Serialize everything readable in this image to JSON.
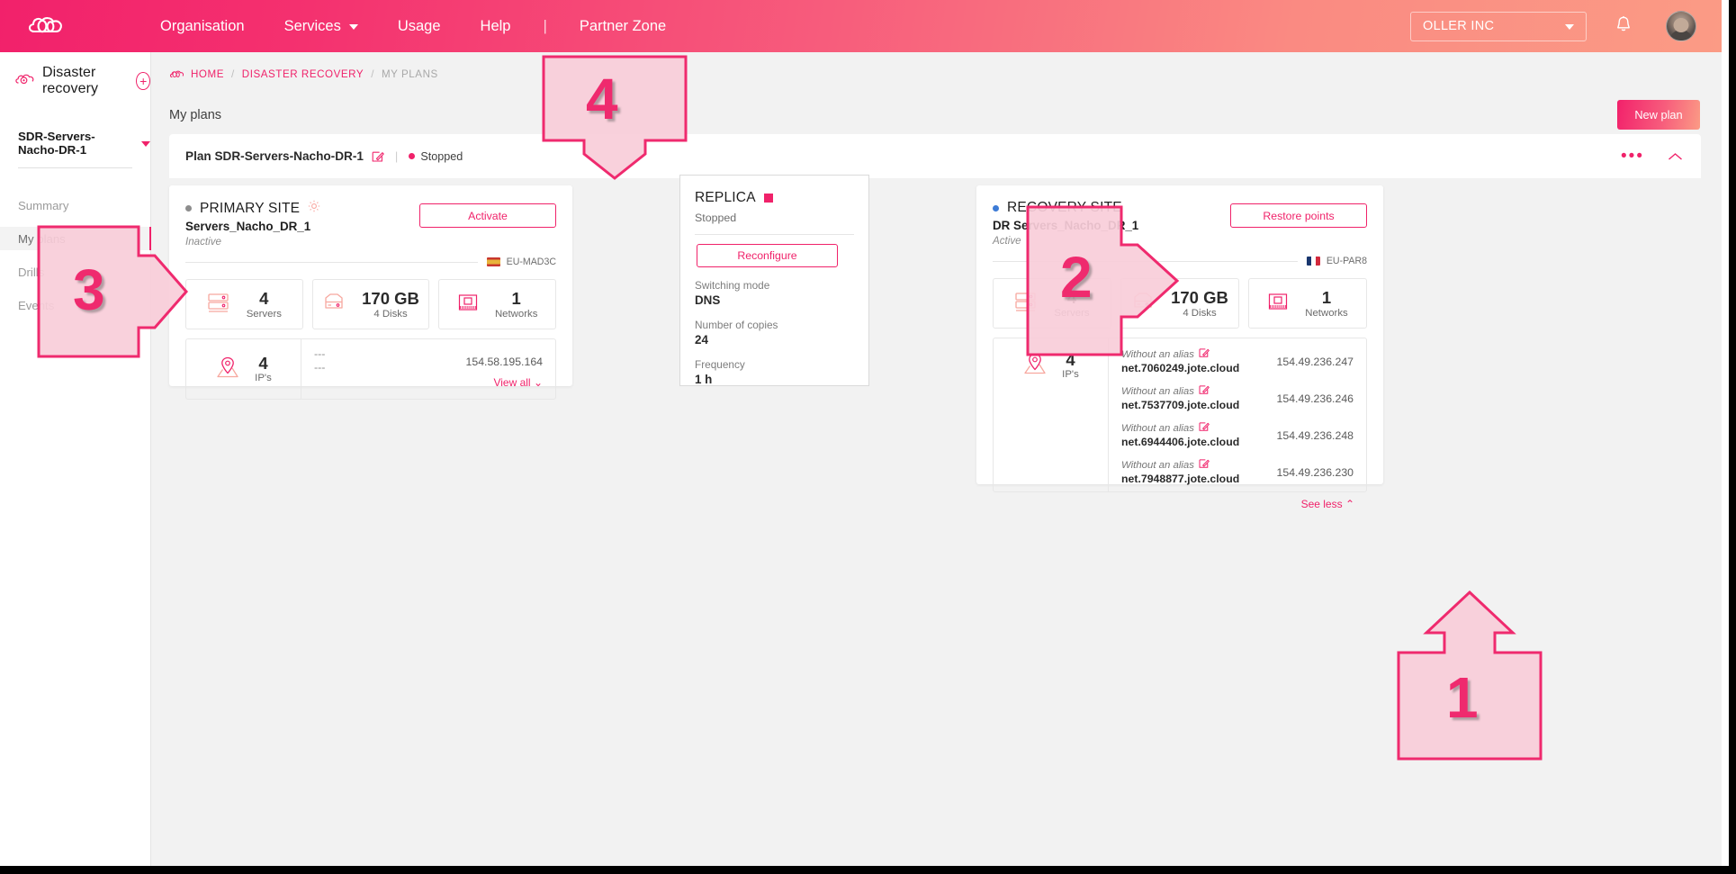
{
  "topnav": {
    "logo_icon": "cloud-logo-icon",
    "links": [
      {
        "label": "Organisation",
        "has_caret": false
      },
      {
        "label": "Services",
        "has_caret": true
      },
      {
        "label": "Usage",
        "has_caret": false
      },
      {
        "label": "Help",
        "has_caret": false
      }
    ],
    "separator": "|",
    "partner_link": "Partner Zone",
    "org_selector": "OLLER INC",
    "bell_icon": "notification-bell-icon",
    "avatar_icon": "user-avatar"
  },
  "sidebar": {
    "service_icon": "disaster-recovery-cloud-icon",
    "title": "Disaster recovery",
    "add_label": "+",
    "plan_selector": "SDR-Servers-Nacho-DR-1",
    "items": [
      {
        "label": "Summary",
        "active": false
      },
      {
        "label": "My plans",
        "active": true
      },
      {
        "label": "Drills",
        "active": false
      },
      {
        "label": "Events",
        "active": false
      }
    ]
  },
  "breadcrumb": {
    "home_icon": "cloud-home-icon",
    "items": [
      "HOME",
      "DISASTER RECOVERY",
      "MY PLANS"
    ],
    "separator": "/"
  },
  "page": {
    "title": "My plans",
    "new_plan_label": "New plan"
  },
  "plan_bar": {
    "name": "Plan SDR-Servers-Nacho-DR-1",
    "edit_icon": "edit-pencil-icon",
    "pipe": "|",
    "status": "Stopped",
    "status_color": "#f0226a",
    "more_icon": "more-dots-icon",
    "collapse_icon": "chevron-up-icon"
  },
  "primary_site": {
    "bullet_color": "#8d8d8d",
    "title": "PRIMARY SITE",
    "gear_icon": "gear-icon",
    "name": "Servers_Nacho_DR_1",
    "state": "Inactive",
    "action_label": "Activate",
    "region": "EU-MAD3C",
    "flag": "flag-es",
    "stats": [
      {
        "icon": "server-stack-icon",
        "value": "4",
        "label": "Servers"
      },
      {
        "icon": "disk-icon",
        "value": "170 GB",
        "label": "4 Disks"
      },
      {
        "icon": "network-icon",
        "value": "1",
        "label": "Networks"
      }
    ],
    "ip_icon": "location-pin-icon",
    "ip_count": "4",
    "ip_label": "IP's",
    "dash_1": "---",
    "dash_2": "---",
    "ip_address": "154.58.195.164",
    "view_all_label": "View all"
  },
  "replica": {
    "title": "REPLICA",
    "status_color": "#f0226a",
    "state": "Stopped",
    "action_label": "Reconfigure",
    "fields": [
      {
        "label": "Switching mode",
        "value": "DNS"
      },
      {
        "label": "Number of copies",
        "value": "24"
      },
      {
        "label": "Frequency",
        "value": "1 h"
      }
    ]
  },
  "recovery_site": {
    "bullet_color": "#3d7bd6",
    "title": "RECOVERY SITE",
    "name": "DR Servers_Nacho_DR_1",
    "state": "Active",
    "action_label": "Restore points",
    "region": "EU-PAR8",
    "flag": "flag-fr",
    "stats": [
      {
        "icon": "server-stack-icon",
        "value": "4",
        "label": "Servers"
      },
      {
        "icon": "disk-icon",
        "value": "170 GB",
        "label": "4 Disks"
      },
      {
        "icon": "network-icon",
        "value": "1",
        "label": "Networks"
      }
    ],
    "ip_icon": "location-pin-icon",
    "ip_count": "4",
    "ip_label": "IP's",
    "ips": [
      {
        "alias": "Without an alias",
        "fqdn": "net.7060249.jote.cloud",
        "address": "154.49.236.247"
      },
      {
        "alias": "Without an alias",
        "fqdn": "net.7537709.jote.cloud",
        "address": "154.49.236.246"
      },
      {
        "alias": "Without an alias",
        "fqdn": "net.6944406.jote.cloud",
        "address": "154.49.236.248"
      },
      {
        "alias": "Without an alias",
        "fqdn": "net.7948877.jote.cloud",
        "address": "154.49.236.230"
      }
    ],
    "see_less_label": "See less"
  },
  "annotations": [
    {
      "id": "1",
      "label": "1",
      "direction": "up"
    },
    {
      "id": "2",
      "label": "2",
      "direction": "right"
    },
    {
      "id": "3",
      "label": "3",
      "direction": "right"
    },
    {
      "id": "4",
      "label": "4",
      "direction": "down"
    }
  ],
  "colors": {
    "accent": "#f0226a",
    "gradient_start": "#f2216b",
    "gradient_end": "#fb9b85",
    "page_bg": "#f2f2f2",
    "callout_fill": "#f9cdd9",
    "callout_stroke": "#ef2a6e"
  }
}
